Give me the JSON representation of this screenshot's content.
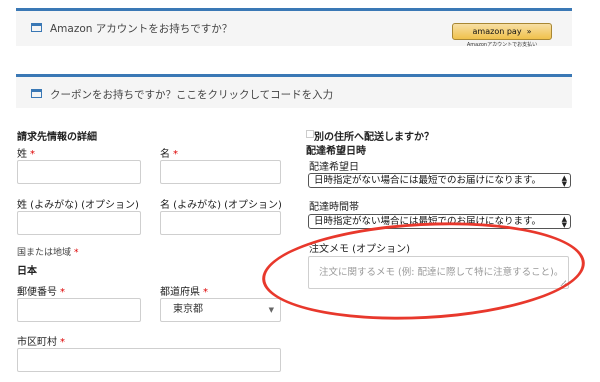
{
  "amazon_notice": {
    "text": "Amazon アカウントをお持ちですか？",
    "button_label": "amazon pay",
    "button_arrows": "»",
    "button_sub": "Amazonアカウントでお支払い"
  },
  "coupon_notice": {
    "text": "クーポンをお持ちですか？ここをクリックしてコードを入力"
  },
  "billing": {
    "heading": "請求先情報の詳細",
    "last_name_label": "姓",
    "first_name_label": "名",
    "last_name_kana_label": "姓 (よみがな) (オプション)",
    "first_name_kana_label": "名 (よみがな) (オプション)",
    "country_label": "国または地域",
    "country_value": "日本",
    "postcode_label": "郵便番号",
    "prefecture_label": "都道府県",
    "prefecture_value": "東京都",
    "city_label": "市区町村",
    "required_mark": "*"
  },
  "shipping": {
    "ship_different_label": "別の住所へ配送しますか？",
    "delivery_heading": "配達希望日時",
    "delivery_date_label": "配達希望日",
    "delivery_date_value": "日時指定がない場合には最短でのお届けになります。",
    "delivery_time_label": "配達時間帯",
    "delivery_time_value": "日時指定がない場合には最短でのお届けになります。",
    "order_notes_label": "注文メモ (オプション)",
    "order_notes_placeholder": "注文に関するメモ (例: 配達に際して特に注意すること)。"
  },
  "colors": {
    "accent": "#3a78b5",
    "required": "#dd0000",
    "highlight_circle": "#e8382c"
  }
}
